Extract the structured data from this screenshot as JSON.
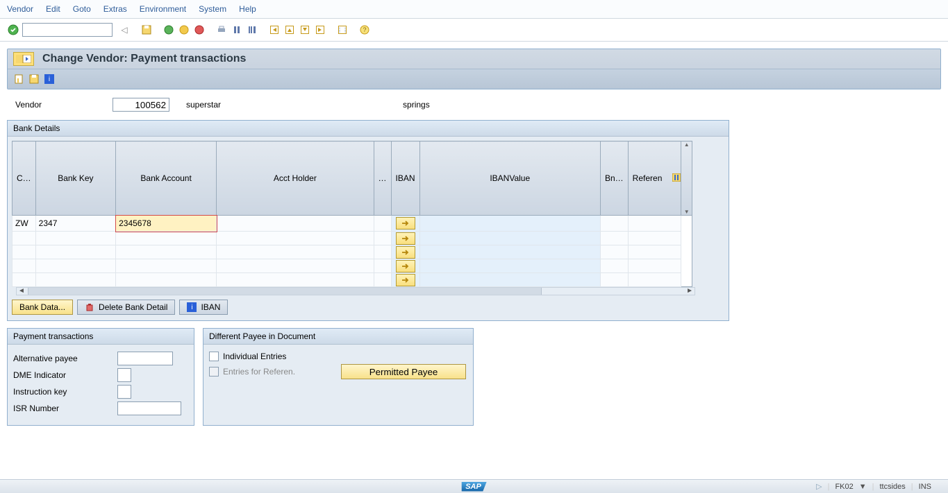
{
  "menubar": [
    "Vendor",
    "Edit",
    "Goto",
    "Extras",
    "Environment",
    "System",
    "Help"
  ],
  "title": "Change Vendor: Payment transactions",
  "vendor": {
    "label": "Vendor",
    "number": "100562",
    "name": "superstar",
    "location": "springs"
  },
  "bank_details": {
    "title": "Bank Details",
    "columns": [
      "C…",
      "Bank Key",
      "Bank Account",
      "Acct Holder",
      "…",
      "IBAN",
      "IBANValue",
      "Bn…",
      "Referen"
    ],
    "rows": [
      {
        "country": "ZW",
        "bank_key": "2347",
        "bank_account": "2345678",
        "acct_holder": "",
        "iban_value": ""
      }
    ],
    "buttons": {
      "bank_data": "Bank Data...",
      "delete": "Delete Bank Detail",
      "iban": "IBAN"
    }
  },
  "payment_trans": {
    "title": "Payment transactions",
    "alt_payee": "Alternative payee",
    "dme": "DME Indicator",
    "instr": "Instruction key",
    "isr": "ISR Number"
  },
  "diff_payee": {
    "title": "Different Payee in Document",
    "individual": "Individual Entries",
    "entries_ref": "Entries for Referen.",
    "permitted": "Permitted Payee"
  },
  "footer": {
    "tcode": "FK02",
    "user": "ttcsides",
    "mode": "INS"
  }
}
